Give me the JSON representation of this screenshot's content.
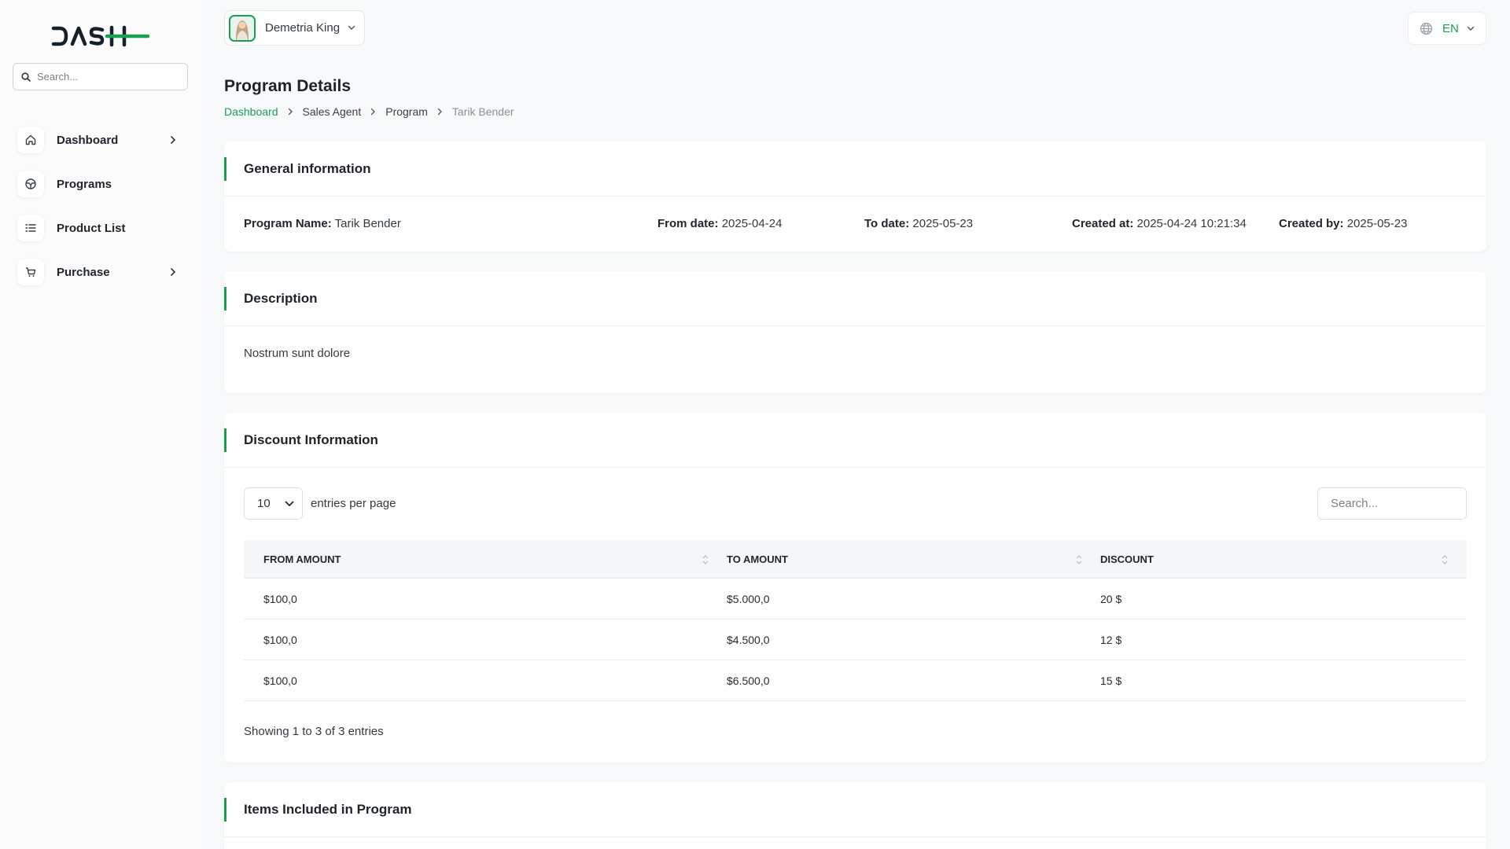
{
  "app": {
    "logo_text": "DASH"
  },
  "search": {
    "placeholder": "Search..."
  },
  "sidebar": {
    "items": [
      {
        "label": "Dashboard",
        "icon": "home-icon",
        "has_submenu": true
      },
      {
        "label": "Programs",
        "icon": "program-icon",
        "has_submenu": false
      },
      {
        "label": "Product List",
        "icon": "list-icon",
        "has_submenu": false
      },
      {
        "label": "Purchase",
        "icon": "cart-icon",
        "has_submenu": true
      }
    ]
  },
  "header": {
    "user_name": "Demetria King",
    "language": "EN"
  },
  "page": {
    "title": "Program Details",
    "breadcrumb": [
      "Dashboard",
      "Sales Agent",
      "Program",
      "Tarik Bender"
    ]
  },
  "general": {
    "title": "General information",
    "fields": [
      {
        "label": "Program Name:",
        "value": "Tarik Bender"
      },
      {
        "label": "From date:",
        "value": "2025-04-24"
      },
      {
        "label": "To date:",
        "value": "2025-05-23"
      },
      {
        "label": "Created at:",
        "value": "2025-04-24 10:21:34"
      },
      {
        "label": "Created by:",
        "value": "2025-05-23"
      }
    ]
  },
  "description": {
    "title": "Description",
    "text": "Nostrum sunt dolore"
  },
  "discount": {
    "title": "Discount Information",
    "page_size": "10",
    "per_page_label": "entries per page",
    "search_placeholder": "Search...",
    "columns": [
      "FROM AMOUNT",
      "TO AMOUNT",
      "DISCOUNT"
    ],
    "rows": [
      [
        "$100,0",
        "$5.000,0",
        "20 $"
      ],
      [
        "$100,0",
        "$4.500,0",
        "12 $"
      ],
      [
        "$100,0",
        "$6.500,0",
        "15 $"
      ]
    ],
    "info": "Showing 1 to 3 of 3 entries"
  },
  "items": {
    "title": "Items Included in Program"
  },
  "colors": {
    "accent": "#1aa053",
    "background": "#f8f9fa",
    "card": "#ffffff"
  }
}
